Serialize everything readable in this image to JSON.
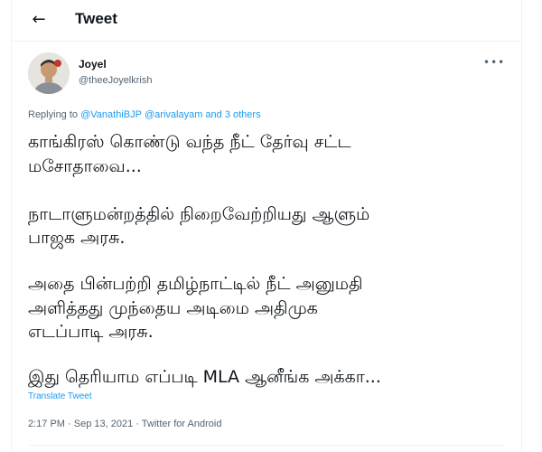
{
  "header": {
    "back_icon": "←",
    "title": "Tweet"
  },
  "author": {
    "avatar_icon": "person-avatar",
    "name": "Joyel",
    "handle": "@theeJoyelkrish",
    "more_icon": "•••"
  },
  "replying": {
    "prefix": "Replying to ",
    "user1": "@VanathiBJP",
    "user2": "@arivalayam",
    "and_text": " and ",
    "others": "3 others"
  },
  "tweet": {
    "line1": "காங்கிரஸ் கொண்டு வந்த நீட் தேர்வு சட்ட",
    "line2": "மசோதாவை...",
    "line3": "நாடாளுமன்றத்தில் நிறைவேற்றியது ஆளும்",
    "line4": "பாஜக அரசு.",
    "line5": "அதை பின்பற்றி தமிழ்நாட்டில் நீட் அனுமதி",
    "line6": "அளித்தது முந்தைய அடிமை அதிமுக",
    "line7": "எடப்பாடி அரசு.",
    "line8": "இது தெரியாம எப்படி MLA ஆனீங்க அக்கா..."
  },
  "translate_label": "Translate Tweet",
  "meta": {
    "time": "2:17 PM",
    "sep1": " · ",
    "date": "Sep 13, 2021",
    "sep2": " · ",
    "source": "Twitter for Android"
  }
}
